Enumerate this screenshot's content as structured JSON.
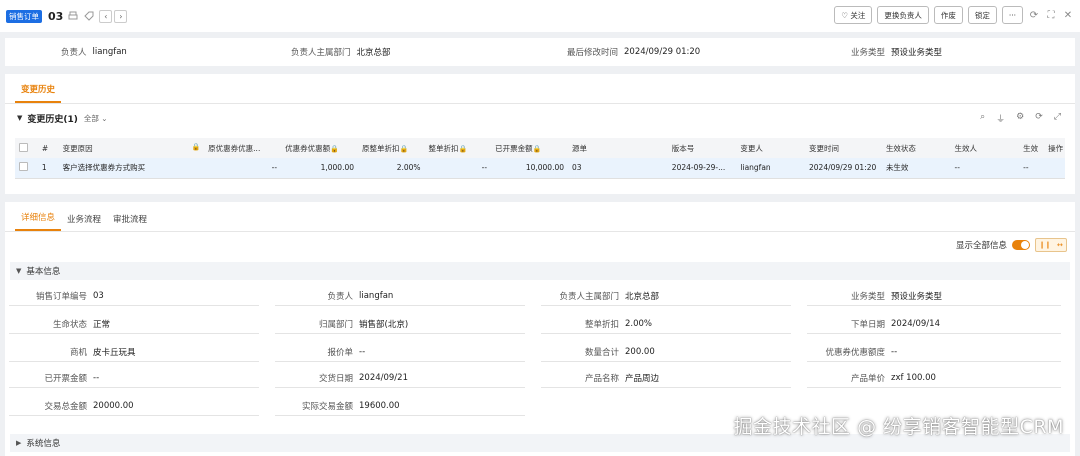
{
  "header": {
    "tag": "销售订单",
    "record_no": "03",
    "buttons": {
      "follow": "♡ 关注",
      "change_owner": "更换负责人",
      "void": "作废",
      "lock": "锁定",
      "more": "···"
    }
  },
  "summary": {
    "owner_label": "负责人",
    "owner_value": "liangfan",
    "dept_label": "负责人主属部门",
    "dept_value": "北京总部",
    "modified_label": "最后修改时间",
    "modified_value": "2024/09/29 01:20",
    "biztype_label": "业务类型",
    "biztype_value": "预设业务类型"
  },
  "history": {
    "tab_label": "变更历史",
    "title": "变更历史(1)",
    "filter": "全部",
    "columns": [
      "#",
      "变更原因",
      "原优惠券优惠...",
      "优惠券优惠额",
      "原整单折扣",
      "整单折扣",
      "已开票金额",
      "源单",
      "版本号",
      "变更人",
      "变更时间",
      "生效状态",
      "生效人",
      "生效",
      "操作"
    ],
    "rows": [
      {
        "index": "1",
        "reason": "客户选择优惠券方式购买",
        "orig_coupon": "--",
        "coupon": "1,000.00",
        "orig_discount": "2.00%",
        "discount": "--",
        "invoiced": "10,000.00",
        "source": "03",
        "version": "2024-09-29-...",
        "changer": "liangfan",
        "change_time": "2024/09/29 01:20",
        "status": "未生效",
        "effector": "--",
        "effect": "--",
        "action": ""
      }
    ]
  },
  "detail": {
    "tabs": [
      "详细信息",
      "业务流程",
      "审批流程"
    ],
    "show_all_label": "显示全部信息",
    "section_basic": "基本信息",
    "section_system": "系统信息",
    "fields": {
      "order_no": {
        "label": "销售订单编号",
        "value": "03"
      },
      "owner": {
        "label": "负责人",
        "value": "liangfan"
      },
      "owner_dept": {
        "label": "负责人主属部门",
        "value": "北京总部"
      },
      "biz_type": {
        "label": "业务类型",
        "value": "预设业务类型"
      },
      "life_status": {
        "label": "生命状态",
        "value": "正常"
      },
      "belong_dept": {
        "label": "归属部门",
        "value": "销售部(北京)"
      },
      "discount": {
        "label": "整单折扣",
        "value": "2.00%"
      },
      "order_date": {
        "label": "下单日期",
        "value": "2024/09/14"
      },
      "opportunity": {
        "label": "商机",
        "value": "皮卡丘玩具"
      },
      "quote": {
        "label": "报价单",
        "value": "--"
      },
      "qty_total": {
        "label": "数量合计",
        "value": "200.00"
      },
      "coupon_amount": {
        "label": "优惠券优惠额度",
        "value": "--"
      },
      "invoiced": {
        "label": "已开票金额",
        "value": "--"
      },
      "delivery_date": {
        "label": "交货日期",
        "value": "2024/09/21"
      },
      "product_name": {
        "label": "产品名称",
        "value": "产品周边"
      },
      "unit_price": {
        "label": "产品单价",
        "value": "zxf 100.00"
      },
      "total_amount": {
        "label": "交易总金额",
        "value": "20000.00"
      },
      "actual_amount": {
        "label": "实际交易金额",
        "value": "19600.00"
      }
    }
  },
  "watermark": "掘金技术社区 @ 纷享销客智能型CRM"
}
